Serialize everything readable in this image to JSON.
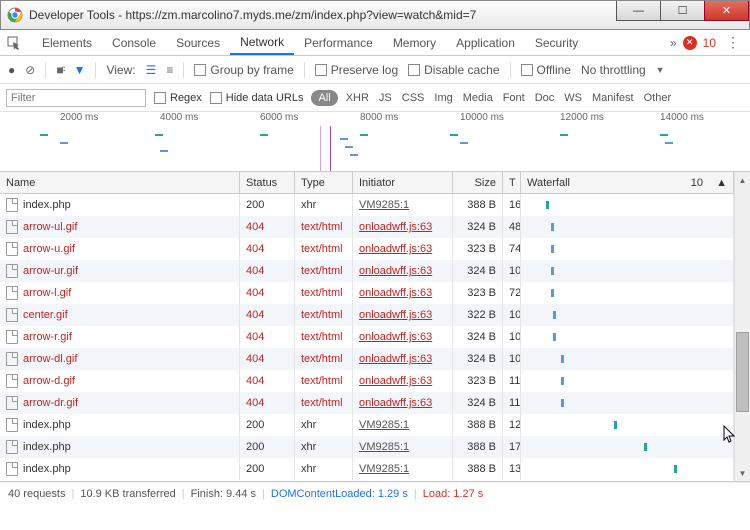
{
  "window": {
    "title": "Developer Tools - https://zm.marcolino7.myds.me/zm/index.php?view=watch&mid=7"
  },
  "tabs": [
    "Elements",
    "Console",
    "Sources",
    "Network",
    "Performance",
    "Memory",
    "Application",
    "Security"
  ],
  "active_tab": "Network",
  "errors_count": "10",
  "toolbar": {
    "view_label": "View:",
    "group_by_frame": "Group by frame",
    "preserve_log": "Preserve log",
    "disable_cache": "Disable cache",
    "offline": "Offline",
    "throttling": "No throttling"
  },
  "filterbar": {
    "filter_placeholder": "Filter",
    "regex": "Regex",
    "hide_data_urls": "Hide data URLs",
    "all": "All",
    "types": [
      "XHR",
      "JS",
      "CSS",
      "Img",
      "Media",
      "Font",
      "Doc",
      "WS",
      "Manifest",
      "Other"
    ]
  },
  "timeline_labels": [
    "2000 ms",
    "4000 ms",
    "6000 ms",
    "8000 ms",
    "10000 ms",
    "12000 ms",
    "14000 ms"
  ],
  "columns": {
    "name": "Name",
    "status": "Status",
    "type": "Type",
    "initiator": "Initiator",
    "size": "Size",
    "time": "T",
    "waterfall": "Waterfall",
    "wf_tick": "10"
  },
  "rows": [
    {
      "name": "index.php",
      "status": "200",
      "type": "xhr",
      "initiator": "VM9285:1",
      "size": "388 B",
      "time": "16",
      "err": false,
      "wf": 12,
      "wc": "g"
    },
    {
      "name": "arrow-ul.gif",
      "status": "404",
      "type": "text/html",
      "initiator": "onloadwff.js:63",
      "size": "324 B",
      "time": "48",
      "err": true,
      "wf": 14,
      "wc": "b"
    },
    {
      "name": "arrow-u.gif",
      "status": "404",
      "type": "text/html",
      "initiator": "onloadwff.js:63",
      "size": "323 B",
      "time": "74",
      "err": true,
      "wf": 14,
      "wc": "b"
    },
    {
      "name": "arrow-ur.gif",
      "status": "404",
      "type": "text/html",
      "initiator": "onloadwff.js:63",
      "size": "324 B",
      "time": "10",
      "err": true,
      "wf": 14,
      "wc": "b"
    },
    {
      "name": "arrow-l.gif",
      "status": "404",
      "type": "text/html",
      "initiator": "onloadwff.js:63",
      "size": "323 B",
      "time": "72",
      "err": true,
      "wf": 14,
      "wc": "b"
    },
    {
      "name": "center.gif",
      "status": "404",
      "type": "text/html",
      "initiator": "onloadwff.js:63",
      "size": "322 B",
      "time": "10",
      "err": true,
      "wf": 15,
      "wc": "b"
    },
    {
      "name": "arrow-r.gif",
      "status": "404",
      "type": "text/html",
      "initiator": "onloadwff.js:63",
      "size": "324 B",
      "time": "10",
      "err": true,
      "wf": 15,
      "wc": "b"
    },
    {
      "name": "arrow-dl.gif",
      "status": "404",
      "type": "text/html",
      "initiator": "onloadwff.js:63",
      "size": "324 B",
      "time": "10",
      "err": true,
      "wf": 19,
      "wc": "b"
    },
    {
      "name": "arrow-d.gif",
      "status": "404",
      "type": "text/html",
      "initiator": "onloadwff.js:63",
      "size": "323 B",
      "time": "11",
      "err": true,
      "wf": 19,
      "wc": "b"
    },
    {
      "name": "arrow-dr.gif",
      "status": "404",
      "type": "text/html",
      "initiator": "onloadwff.js:63",
      "size": "324 B",
      "time": "11",
      "err": true,
      "wf": 19,
      "wc": "b"
    },
    {
      "name": "index.php",
      "status": "200",
      "type": "xhr",
      "initiator": "VM9285:1",
      "size": "388 B",
      "time": "12",
      "err": false,
      "wf": 44,
      "wc": "g"
    },
    {
      "name": "index.php",
      "status": "200",
      "type": "xhr",
      "initiator": "VM9285:1",
      "size": "388 B",
      "time": "17",
      "err": false,
      "wf": 58,
      "wc": "g"
    },
    {
      "name": "index.php",
      "status": "200",
      "type": "xhr",
      "initiator": "VM9285:1",
      "size": "388 B",
      "time": "13",
      "err": false,
      "wf": 72,
      "wc": "g"
    }
  ],
  "statusbar": {
    "requests": "40 requests",
    "transferred": "10.9 KB transferred",
    "finish": "Finish: 9.44 s",
    "domc": "DOMContentLoaded: 1.29 s",
    "load": "Load: 1.27 s"
  }
}
